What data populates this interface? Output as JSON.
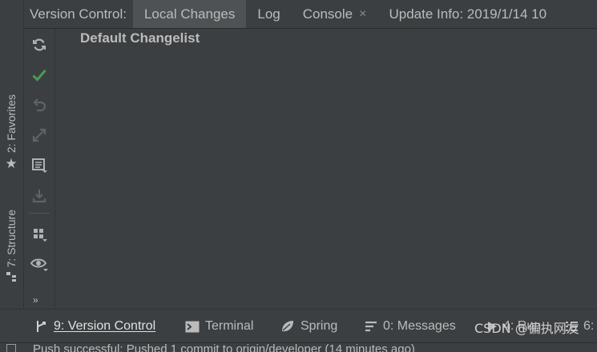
{
  "header": {
    "title": "Version Control:",
    "tabs": [
      {
        "label": "Local Changes"
      },
      {
        "label": "Log"
      },
      {
        "label": "Console",
        "close": "×"
      },
      {
        "label": "Update Info: 2019/1/14 10"
      }
    ]
  },
  "left_stripe": {
    "favorites": {
      "label": "2: Favorites",
      "icon": "star-icon"
    },
    "structure": {
      "label": "7: Structure",
      "icon": "structure-icon"
    }
  },
  "toolbar": {
    "buttons": [
      "refresh-icon",
      "commit-icon",
      "rollback-icon",
      "move-icon",
      "changelist-icon",
      "shelve-icon",
      "group-icon",
      "show-icon"
    ],
    "more": "»"
  },
  "changes": {
    "changelist": "Default Changelist"
  },
  "bottom_bar": {
    "items": [
      {
        "label": "9: Version Control",
        "icon": "vcs-icon",
        "active": true
      },
      {
        "label": "Terminal",
        "icon": "terminal-icon"
      },
      {
        "label": "Spring",
        "icon": "spring-icon"
      },
      {
        "label": "0: Messages",
        "icon": "messages-icon"
      },
      {
        "label": "4: Run",
        "icon": "run-icon"
      },
      {
        "label": "6:",
        "icon": "todo-icon"
      }
    ],
    "watermark": "CSDN @偏执网友"
  },
  "status": {
    "message": "Push successful: Pushed 1 commit to origin/developer (14 minutes ago)"
  },
  "colors": {
    "background": "#3c3f41",
    "active_tab": "#4e5254",
    "commit_green": "#499c54",
    "highlight_red": "#e8202a"
  }
}
